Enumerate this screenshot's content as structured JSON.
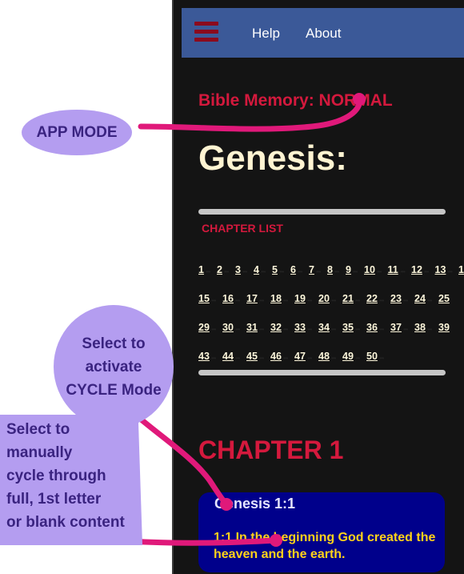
{
  "nav": {
    "help_label": "Help",
    "about_label": "About",
    "menu_icon": "hamburger-menu-icon",
    "background": "#3b5998",
    "menu_color": "#8b0b1e"
  },
  "app_mode_title": "Bible Memory: NORMAL",
  "book_title": "Genesis:",
  "chapter_list_label": "CHAPTER LIST",
  "chapters": [
    [
      "1",
      "2",
      "3",
      "4",
      "5",
      "6",
      "7",
      "8",
      "9",
      "10",
      "11",
      "12",
      "13",
      "1"
    ],
    [
      "15",
      "16",
      "17",
      "18",
      "19",
      "20",
      "21",
      "22",
      "23",
      "24",
      "25"
    ],
    [
      "29",
      "30",
      "31",
      "32",
      "33",
      "34",
      "35",
      "36",
      "37",
      "38",
      "39"
    ],
    [
      "43",
      "44",
      "45",
      "46",
      "47",
      "48",
      "49",
      "50"
    ]
  ],
  "chapter_heading": "CHAPTER 1",
  "verse": {
    "reference": "Genesis 1:1",
    "text": "1:1 In the beginning God created the heaven and the earth."
  },
  "annotations": {
    "app_mode": "APP MODE",
    "cycle_lines": [
      "Select to",
      "activate",
      "CYCLE Mode"
    ],
    "manual_lines": [
      "Select to",
      "manually",
      "cycle through",
      "full, 1st letter",
      "or blank content"
    ]
  },
  "colors": {
    "accent_red": "#d4193d",
    "verse_card": "#00008b",
    "verse_text": "#ffd21a",
    "annotation_bubble": "#b49df0",
    "annotation_arrow": "#e0197a"
  }
}
